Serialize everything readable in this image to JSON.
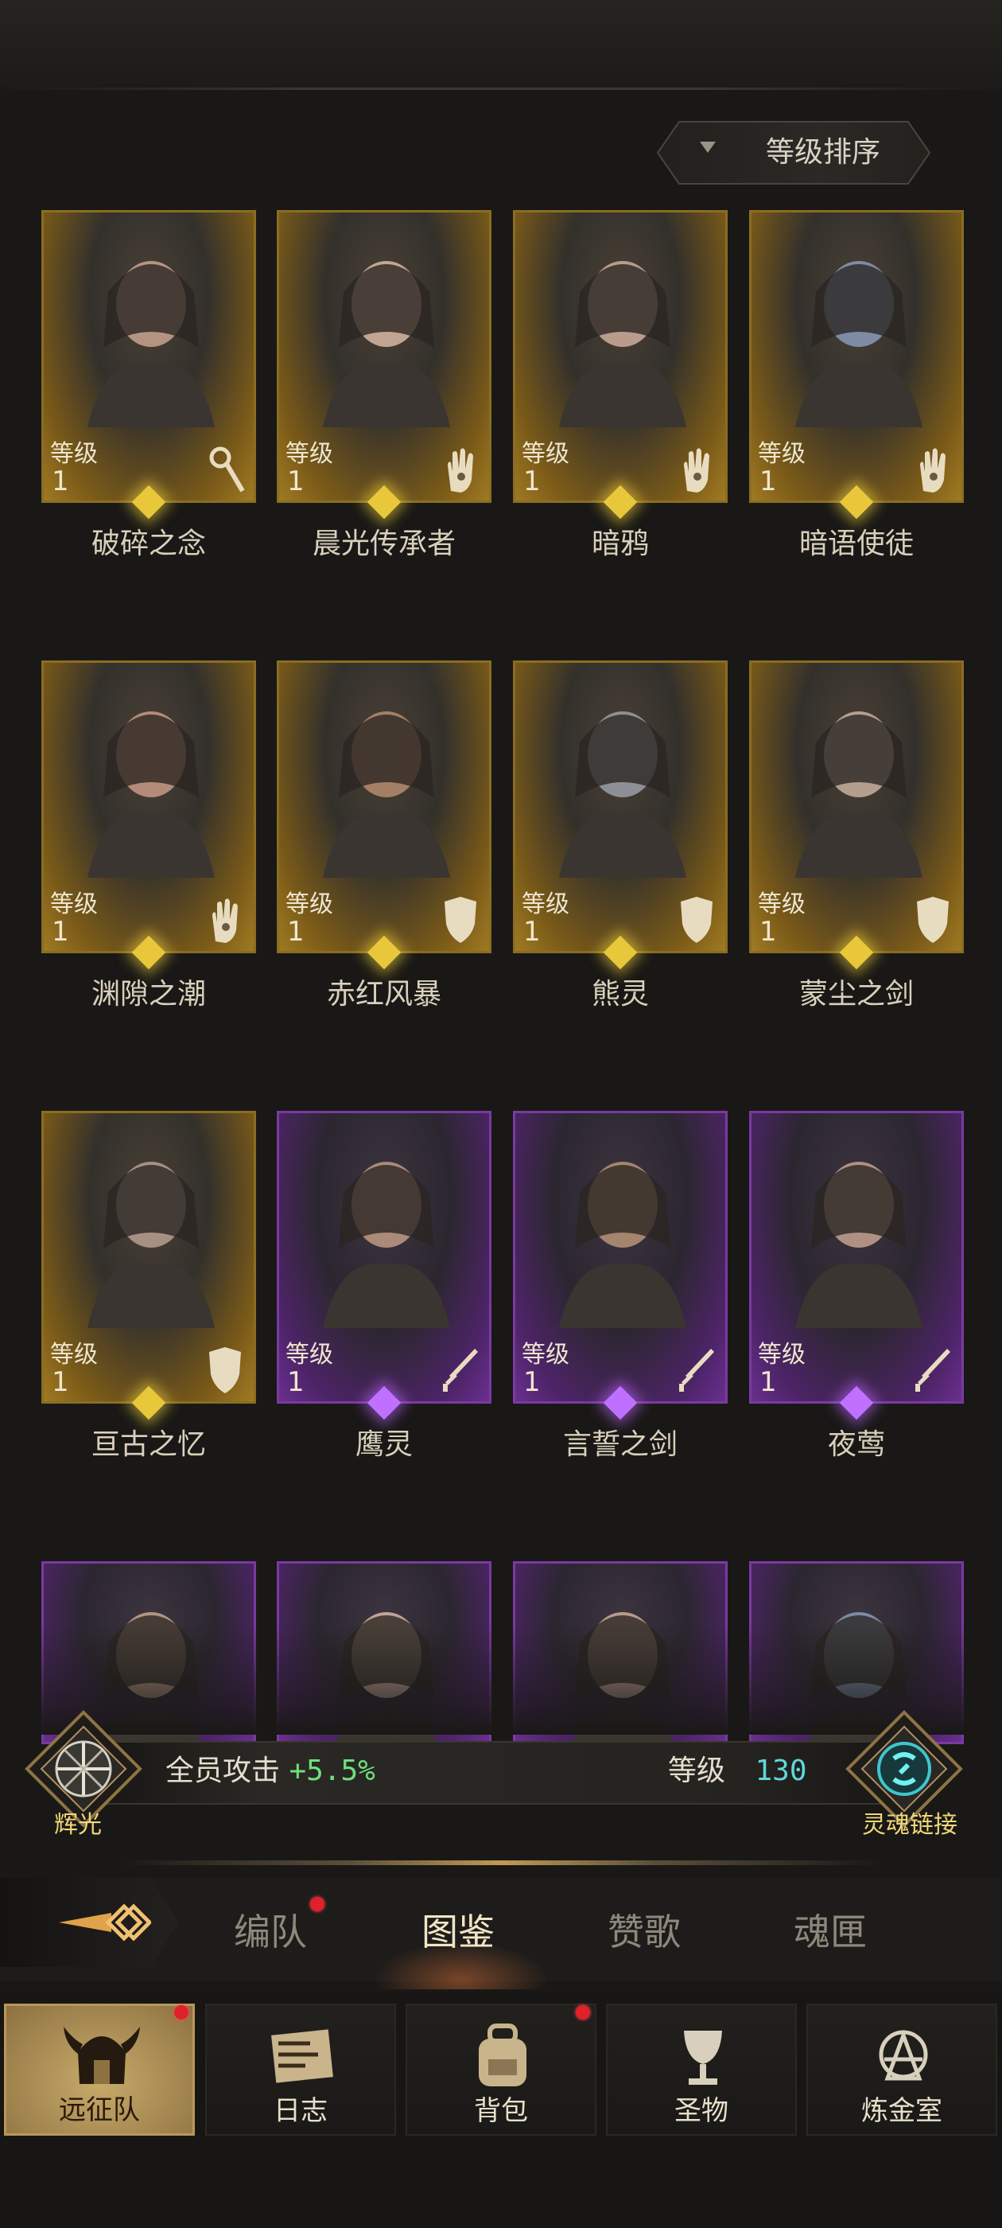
{
  "sort": {
    "label": "等级排序"
  },
  "heroes": [
    {
      "name": "破碎之念",
      "level_label": "等级",
      "level": "1",
      "rarity": "gold",
      "role_icon": "staff-icon"
    },
    {
      "name": "晨光传承者",
      "level_label": "等级",
      "level": "1",
      "rarity": "gold",
      "role_icon": "hand-icon"
    },
    {
      "name": "暗鸦",
      "level_label": "等级",
      "level": "1",
      "rarity": "gold",
      "role_icon": "hand-icon"
    },
    {
      "name": "暗语使徒",
      "level_label": "等级",
      "level": "1",
      "rarity": "gold",
      "role_icon": "hand-icon"
    },
    {
      "name": "渊隙之潮",
      "level_label": "等级",
      "level": "1",
      "rarity": "gold",
      "role_icon": "hand-icon"
    },
    {
      "name": "赤红风暴",
      "level_label": "等级",
      "level": "1",
      "rarity": "gold",
      "role_icon": "shield-icon"
    },
    {
      "name": "熊灵",
      "level_label": "等级",
      "level": "1",
      "rarity": "gold",
      "role_icon": "shield-icon"
    },
    {
      "name": "蒙尘之剑",
      "level_label": "等级",
      "level": "1",
      "rarity": "gold",
      "role_icon": "shield-icon"
    },
    {
      "name": "亘古之忆",
      "level_label": "等级",
      "level": "1",
      "rarity": "gold",
      "role_icon": "shield-icon"
    },
    {
      "name": "鹰灵",
      "level_label": "等级",
      "level": "1",
      "rarity": "purple",
      "role_icon": "sword-icon"
    },
    {
      "name": "言誓之剑",
      "level_label": "等级",
      "level": "1",
      "rarity": "purple",
      "role_icon": "sword-icon"
    },
    {
      "name": "夜莺",
      "level_label": "等级",
      "level": "1",
      "rarity": "purple",
      "role_icon": "sword-icon"
    },
    {
      "name": "",
      "level_label": "",
      "level": "",
      "rarity": "purple",
      "role_icon": ""
    },
    {
      "name": "",
      "level_label": "",
      "level": "",
      "rarity": "purple",
      "role_icon": ""
    },
    {
      "name": "",
      "level_label": "",
      "level": "",
      "rarity": "purple",
      "role_icon": ""
    },
    {
      "name": "",
      "level_label": "",
      "level": "",
      "rarity": "purple",
      "role_icon": ""
    }
  ],
  "stats": {
    "left_emblem_label": "辉光",
    "bonus_text": "全员攻击",
    "bonus_value": "+5.5%",
    "level_label": "等级",
    "level_value": "130",
    "right_emblem_label": "灵魂链接"
  },
  "tabs": [
    {
      "label": "编队",
      "active": false,
      "badge": true
    },
    {
      "label": "图鉴",
      "active": true,
      "badge": false
    },
    {
      "label": "赞歌",
      "active": false,
      "badge": false
    },
    {
      "label": "魂匣",
      "active": false,
      "badge": false
    }
  ],
  "nav": [
    {
      "label": "远征队",
      "icon": "horned-helmet-icon",
      "active": true,
      "badge": true
    },
    {
      "label": "日志",
      "icon": "scroll-icon",
      "active": false,
      "badge": false
    },
    {
      "label": "背包",
      "icon": "backpack-icon",
      "active": false,
      "badge": true
    },
    {
      "label": "圣物",
      "icon": "chalice-icon",
      "active": false,
      "badge": false
    },
    {
      "label": "炼金室",
      "icon": "alchemy-icon",
      "active": false,
      "badge": false
    }
  ],
  "colors": {
    "gold_frame": "#8a6d22",
    "purple_frame": "#7a3aa0",
    "bonus_green": "#6fe07a",
    "level_cyan": "#5fd8dc",
    "badge_red": "#e0202a"
  }
}
